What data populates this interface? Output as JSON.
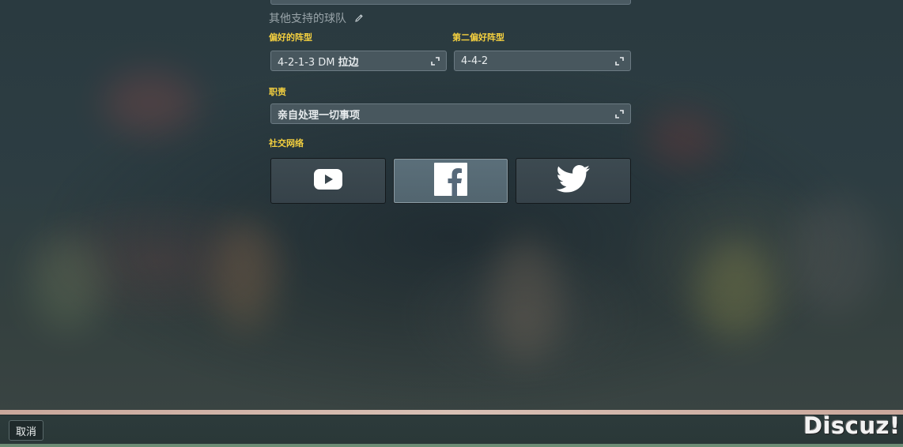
{
  "other_teams": {
    "title": "其他支持的球队",
    "icon": "pencil-icon"
  },
  "preferred_formation": {
    "label": "偏好的阵型",
    "value_prefix": "4-2-1-3 DM ",
    "value_suffix": "拉边"
  },
  "second_formation": {
    "label": "第二偏好阵型",
    "value": "4-4-2"
  },
  "duty": {
    "label": "职责",
    "value": "亲自处理一切事项"
  },
  "social": {
    "label": "社交网络",
    "items": [
      {
        "icon": "youtube-icon"
      },
      {
        "icon": "facebook-icon",
        "active": true
      },
      {
        "icon": "twitter-icon"
      }
    ]
  },
  "footer": {
    "cancel_label": "取消"
  },
  "watermark": {
    "text": "Discuz!"
  },
  "colors": {
    "label_yellow": "#f4d03f",
    "field_bg": "#48575e",
    "active_button": "#5b6f7a"
  }
}
